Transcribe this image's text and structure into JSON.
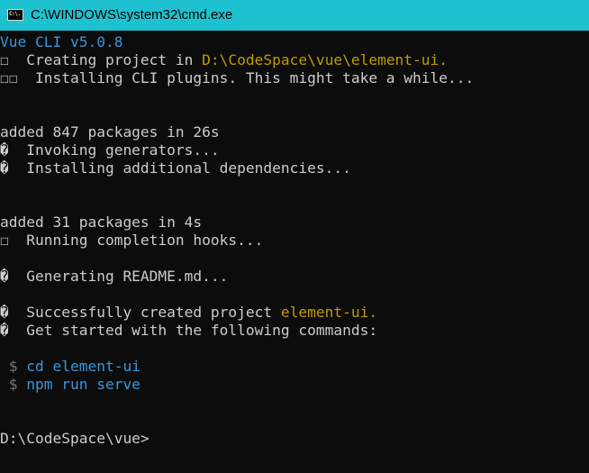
{
  "window": {
    "title": "C:\\WINDOWS\\system32\\cmd.exe",
    "icon_label": "C:\\."
  },
  "console": {
    "line1": "Vue CLI v5.0.8",
    "line2_prefix": "☐  Creating project in ",
    "line2_path": "D:\\CodeSpace\\vue\\element-ui",
    "line2_suffix": ".",
    "line3": "☐☐  Installing CLI plugins. This might take a while...",
    "line6": "added 847 packages in 26s",
    "line7": "�  Invoking generators...",
    "line8": "�  Installing additional dependencies...",
    "line11": "added 31 packages in 4s",
    "line12": "☐  Running completion hooks...",
    "line14": "�  Generating README.md...",
    "line16_prefix": "�  Successfully created project ",
    "line16_name": "element-ui",
    "line16_suffix": ".",
    "line17": "�  Get started with the following commands:",
    "line19_dollar": " $",
    "line19_cmd": " cd element-ui",
    "line20_dollar": " $",
    "line20_cmd": " npm run serve",
    "prompt": "D:\\CodeSpace\\vue>"
  },
  "colors": {
    "titlebar": "#1ec1cf",
    "background": "#0c0c0c",
    "text": "#cccccc",
    "blue": "#3a96dd",
    "yellow": "#c19c00"
  }
}
